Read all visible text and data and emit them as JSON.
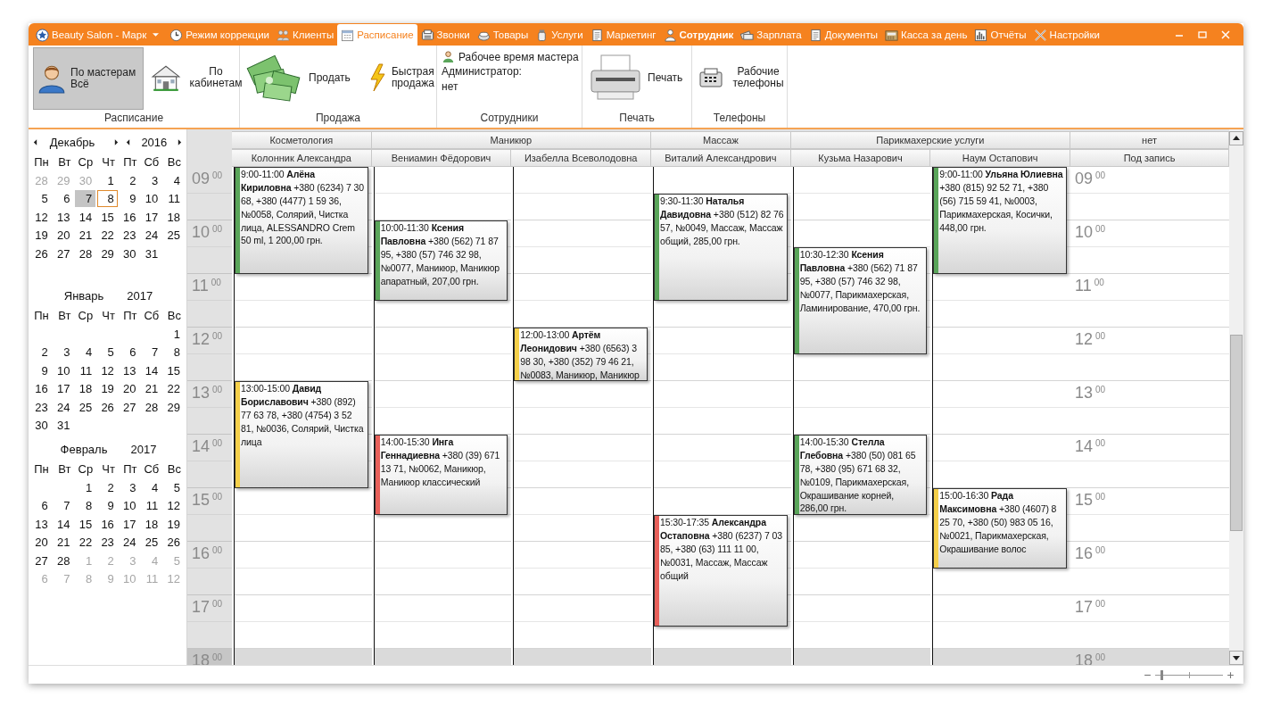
{
  "window": {
    "app_menu": "Beauty Salon - Марк"
  },
  "tabs": [
    {
      "label": "Режим коррекции",
      "selected": false,
      "emphasized": false
    },
    {
      "label": "Клиенты",
      "selected": false,
      "emphasized": false
    },
    {
      "label": "Расписание",
      "selected": true,
      "emphasized": false
    },
    {
      "label": "Звонки",
      "selected": false,
      "emphasized": false
    },
    {
      "label": "Товары",
      "selected": false,
      "emphasized": false
    },
    {
      "label": "Услуги",
      "selected": false,
      "emphasized": false
    },
    {
      "label": "Маркетинг",
      "selected": false,
      "emphasized": false
    },
    {
      "label": "Сотрудник",
      "selected": false,
      "emphasized": true
    },
    {
      "label": "Зарплата",
      "selected": false,
      "emphasized": false
    },
    {
      "label": "Документы",
      "selected": false,
      "emphasized": false
    },
    {
      "label": "Касса за день",
      "selected": false,
      "emphasized": false
    },
    {
      "label": "Отчёты",
      "selected": false,
      "emphasized": false
    },
    {
      "label": "Настройки",
      "selected": false,
      "emphasized": false
    }
  ],
  "ribbon": {
    "schedule_group": {
      "title": "Расписание",
      "by_masters": {
        "label": "По мастерам",
        "value": "Всё",
        "selected": true
      },
      "by_rooms": {
        "label": "По кабинетам",
        "selected": false
      }
    },
    "sale_group": {
      "title": "Продажа",
      "sell": "Продать",
      "quick_sale": "Быстрая продажа"
    },
    "staff_group": {
      "title": "Сотрудники",
      "work_time": "Рабочее время мастера",
      "administrator_label": "Администратор:",
      "administrator_value": "нет"
    },
    "print_group": {
      "title": "Печать",
      "print": "Печать"
    },
    "phones_group": {
      "title": "Телефоны",
      "work_phones": "Рабочие телефоны"
    }
  },
  "mini_calendar": [
    {
      "month": "Декабрь",
      "year": "2016",
      "navigation": true,
      "weekdays": [
        "Пн",
        "Вт",
        "Ср",
        "Чт",
        "Пт",
        "Сб",
        "Вс"
      ],
      "weeks": [
        [
          {
            "d": "28",
            "muted": true,
            "selected": false,
            "today": false
          },
          {
            "d": "29",
            "muted": true,
            "selected": false,
            "today": false
          },
          {
            "d": "30",
            "muted": true,
            "selected": false,
            "today": false
          },
          {
            "d": "1",
            "muted": false,
            "selected": false,
            "today": false
          },
          {
            "d": "2",
            "muted": false,
            "selected": false,
            "today": false
          },
          {
            "d": "3",
            "muted": false,
            "selected": false,
            "today": false
          },
          {
            "d": "4",
            "muted": false,
            "selected": false,
            "today": false
          }
        ],
        [
          {
            "d": "5",
            "muted": false,
            "selected": false,
            "today": false
          },
          {
            "d": "6",
            "muted": false,
            "selected": false,
            "today": false
          },
          {
            "d": "7",
            "muted": false,
            "selected": true,
            "today": false
          },
          {
            "d": "8",
            "muted": false,
            "selected": false,
            "today": true
          },
          {
            "d": "9",
            "muted": false,
            "selected": false,
            "today": false
          },
          {
            "d": "10",
            "muted": false,
            "selected": false,
            "today": false
          },
          {
            "d": "11",
            "muted": false,
            "selected": false,
            "today": false
          }
        ],
        [
          {
            "d": "12",
            "muted": false,
            "selected": false,
            "today": false
          },
          {
            "d": "13",
            "muted": false,
            "selected": false,
            "today": false
          },
          {
            "d": "14",
            "muted": false,
            "selected": false,
            "today": false
          },
          {
            "d": "15",
            "muted": false,
            "selected": false,
            "today": false
          },
          {
            "d": "16",
            "muted": false,
            "selected": false,
            "today": false
          },
          {
            "d": "17",
            "muted": false,
            "selected": false,
            "today": false
          },
          {
            "d": "18",
            "muted": false,
            "selected": false,
            "today": false
          }
        ],
        [
          {
            "d": "19",
            "muted": false,
            "selected": false,
            "today": false
          },
          {
            "d": "20",
            "muted": false,
            "selected": false,
            "today": false
          },
          {
            "d": "21",
            "muted": false,
            "selected": false,
            "today": false
          },
          {
            "d": "22",
            "muted": false,
            "selected": false,
            "today": false
          },
          {
            "d": "23",
            "muted": false,
            "selected": false,
            "today": false
          },
          {
            "d": "24",
            "muted": false,
            "selected": false,
            "today": false
          },
          {
            "d": "25",
            "muted": false,
            "selected": false,
            "today": false
          }
        ],
        [
          {
            "d": "26",
            "muted": false,
            "selected": false,
            "today": false
          },
          {
            "d": "27",
            "muted": false,
            "selected": false,
            "today": false
          },
          {
            "d": "28",
            "muted": false,
            "selected": false,
            "today": false
          },
          {
            "d": "29",
            "muted": false,
            "selected": false,
            "today": false
          },
          {
            "d": "30",
            "muted": false,
            "selected": false,
            "today": false
          },
          {
            "d": "31",
            "muted": false,
            "selected": false,
            "today": false
          }
        ]
      ]
    },
    {
      "month": "Январь",
      "year": "2017",
      "weekdays": [
        "Пн",
        "Вт",
        "Ср",
        "Чт",
        "Пт",
        "Сб",
        "Вс"
      ],
      "weeks": [
        [
          {
            "d": "1",
            "muted": false,
            "selected": false,
            "today": false
          }
        ],
        [
          {
            "d": "2",
            "muted": false,
            "selected": false,
            "today": false
          },
          {
            "d": "3",
            "muted": false,
            "selected": false,
            "today": false
          },
          {
            "d": "4",
            "muted": false,
            "selected": false,
            "today": false
          },
          {
            "d": "5",
            "muted": false,
            "selected": false,
            "today": false
          },
          {
            "d": "6",
            "muted": false,
            "selected": false,
            "today": false
          },
          {
            "d": "7",
            "muted": false,
            "selected": false,
            "today": false
          },
          {
            "d": "8",
            "muted": false,
            "selected": false,
            "today": false
          }
        ],
        [
          {
            "d": "9",
            "muted": false,
            "selected": false,
            "today": false
          },
          {
            "d": "10",
            "muted": false,
            "selected": false,
            "today": false
          },
          {
            "d": "11",
            "muted": false,
            "selected": false,
            "today": false
          },
          {
            "d": "12",
            "muted": false,
            "selected": false,
            "today": false
          },
          {
            "d": "13",
            "muted": false,
            "selected": false,
            "today": false
          },
          {
            "d": "14",
            "muted": false,
            "selected": false,
            "today": false
          },
          {
            "d": "15",
            "muted": false,
            "selected": false,
            "today": false
          }
        ],
        [
          {
            "d": "16",
            "muted": false,
            "selected": false,
            "today": false
          },
          {
            "d": "17",
            "muted": false,
            "selected": false,
            "today": false
          },
          {
            "d": "18",
            "muted": false,
            "selected": false,
            "today": false
          },
          {
            "d": "19",
            "muted": false,
            "selected": false,
            "today": false
          },
          {
            "d": "20",
            "muted": false,
            "selected": false,
            "today": false
          },
          {
            "d": "21",
            "muted": false,
            "selected": false,
            "today": false
          },
          {
            "d": "22",
            "muted": false,
            "selected": false,
            "today": false
          }
        ],
        [
          {
            "d": "23",
            "muted": false,
            "selected": false,
            "today": false
          },
          {
            "d": "24",
            "muted": false,
            "selected": false,
            "today": false
          },
          {
            "d": "25",
            "muted": false,
            "selected": false,
            "today": false
          },
          {
            "d": "26",
            "muted": false,
            "selected": false,
            "today": false
          },
          {
            "d": "27",
            "muted": false,
            "selected": false,
            "today": false
          },
          {
            "d": "28",
            "muted": false,
            "selected": false,
            "today": false
          },
          {
            "d": "29",
            "muted": false,
            "selected": false,
            "today": false
          }
        ],
        [
          {
            "d": "30",
            "muted": false,
            "selected": false,
            "today": false
          },
          {
            "d": "31",
            "muted": false,
            "selected": false,
            "today": false
          }
        ]
      ]
    },
    {
      "month": "Февраль",
      "year": "2017",
      "weekdays": [
        "Пн",
        "Вт",
        "Ср",
        "Чт",
        "Пт",
        "Сб",
        "Вс"
      ],
      "weeks": [
        [
          {
            "d": "1",
            "muted": false,
            "selected": false,
            "today": false
          },
          {
            "d": "2",
            "muted": false,
            "selected": false,
            "today": false
          },
          {
            "d": "3",
            "muted": false,
            "selected": false,
            "today": false
          },
          {
            "d": "4",
            "muted": false,
            "selected": false,
            "today": false
          },
          {
            "d": "5",
            "muted": false,
            "selected": false,
            "today": false
          }
        ],
        [
          {
            "d": "6",
            "muted": false,
            "selected": false,
            "today": false
          },
          {
            "d": "7",
            "muted": false,
            "selected": false,
            "today": false
          },
          {
            "d": "8",
            "muted": false,
            "selected": false,
            "today": false
          },
          {
            "d": "9",
            "muted": false,
            "selected": false,
            "today": false
          },
          {
            "d": "10",
            "muted": false,
            "selected": false,
            "today": false
          },
          {
            "d": "11",
            "muted": false,
            "selected": false,
            "today": false
          },
          {
            "d": "12",
            "muted": false,
            "selected": false,
            "today": false
          }
        ],
        [
          {
            "d": "13",
            "muted": false,
            "selected": false,
            "today": false
          },
          {
            "d": "14",
            "muted": false,
            "selected": false,
            "today": false
          },
          {
            "d": "15",
            "muted": false,
            "selected": false,
            "today": false
          },
          {
            "d": "16",
            "muted": false,
            "selected": false,
            "today": false
          },
          {
            "d": "17",
            "muted": false,
            "selected": false,
            "today": false
          },
          {
            "d": "18",
            "muted": false,
            "selected": false,
            "today": false
          },
          {
            "d": "19",
            "muted": false,
            "selected": false,
            "today": false
          }
        ],
        [
          {
            "d": "20",
            "muted": false,
            "selected": false,
            "today": false
          },
          {
            "d": "21",
            "muted": false,
            "selected": false,
            "today": false
          },
          {
            "d": "22",
            "muted": false,
            "selected": false,
            "today": false
          },
          {
            "d": "23",
            "muted": false,
            "selected": false,
            "today": false
          },
          {
            "d": "24",
            "muted": false,
            "selected": false,
            "today": false
          },
          {
            "d": "25",
            "muted": false,
            "selected": false,
            "today": false
          },
          {
            "d": "26",
            "muted": false,
            "selected": false,
            "today": false
          }
        ],
        [
          {
            "d": "27",
            "muted": false,
            "selected": false,
            "today": false
          },
          {
            "d": "28",
            "muted": false,
            "selected": false,
            "today": false
          },
          {
            "d": "1",
            "muted": true,
            "selected": false,
            "today": false
          },
          {
            "d": "2",
            "muted": true,
            "selected": false,
            "today": false
          },
          {
            "d": "3",
            "muted": true,
            "selected": false,
            "today": false
          },
          {
            "d": "4",
            "muted": true,
            "selected": false,
            "today": false
          },
          {
            "d": "5",
            "muted": true,
            "selected": false,
            "today": false
          }
        ],
        [
          {
            "d": "6",
            "muted": true,
            "selected": false,
            "today": false
          },
          {
            "d": "7",
            "muted": true,
            "selected": false,
            "today": false
          },
          {
            "d": "8",
            "muted": true,
            "selected": false,
            "today": false
          },
          {
            "d": "9",
            "muted": true,
            "selected": false,
            "today": false
          },
          {
            "d": "10",
            "muted": true,
            "selected": false,
            "today": false
          },
          {
            "d": "11",
            "muted": true,
            "selected": false,
            "today": false
          },
          {
            "d": "12",
            "muted": true,
            "selected": false,
            "today": false
          }
        ]
      ]
    }
  ],
  "schedule": {
    "time_column": [
      {
        "hour": "09",
        "minutes": "00",
        "working": true
      },
      {
        "hour": "10",
        "minutes": "00",
        "working": true
      },
      {
        "hour": "11",
        "minutes": "00",
        "working": true
      },
      {
        "hour": "12",
        "minutes": "00",
        "working": true
      },
      {
        "hour": "13",
        "minutes": "00",
        "working": true
      },
      {
        "hour": "14",
        "minutes": "00",
        "working": true
      },
      {
        "hour": "15",
        "minutes": "00",
        "working": true
      },
      {
        "hour": "16",
        "minutes": "00",
        "working": true
      },
      {
        "hour": "17",
        "minutes": "00",
        "working": true
      },
      {
        "hour": "18",
        "minutes": "00",
        "working": false
      }
    ],
    "groups": [
      {
        "name": "Косметология",
        "staff": [
          {
            "name": "Колонник Александра",
            "kind": "staff",
            "appointments": [
              {
                "text": "9:00-11:00 **Алёна Кириловна** +380 (6234) 7 30 68, +380 (4477) 1 59 36, №0058, Солярий, Чистка лица, ALESSANDRO Crem 50 ml, 1 200,00 грн.",
                "color": "#5aa55a"
              },
              {
                "text": "13:00-15:00 **Давид Бориславович** +380 (892) 77 63 78, +380 (4754) 3 52 81, №0036, Солярий, Чистка лица",
                "color": "#f5d04a"
              }
            ]
          }
        ]
      },
      {
        "name": "Маникюр",
        "staff": [
          {
            "name": "Вениамин Фёдорович",
            "kind": "staff",
            "appointments": [
              {
                "text": "10:00-11:30 **Ксения Павловна** +380 (562) 71 87 95, +380 (57) 746 32 98, №0077, Маникюр, Маникюр апаратный, 207,00 грн.",
                "color": "#5aa55a"
              },
              {
                "text": "14:00-15:30 **Инга Геннадиевна** +380 (39) 671 13 71, №0062, Маникюр, Маникюр классический",
                "color": "#e8605a"
              }
            ]
          },
          {
            "name": "Изабелла Всеволодовна",
            "kind": "staff",
            "appointments": [
              {
                "text": "12:00-13:00 **Артём Леонидович** +380 (6563) 3 98 30, +380 (352) 79 46 21, №0083, Маникюр, Маникюр",
                "color": "#f5d04a"
              }
            ]
          }
        ]
      },
      {
        "name": "Массаж",
        "staff": [
          {
            "name": "Виталий Александрович",
            "kind": "staff",
            "appointments": [
              {
                "text": "9:30-11:30 **Наталья Давидовна** +380 (512) 82 76 57, №0049, Массаж, Массаж общий, 285,00 грн.",
                "color": "#5aa55a"
              },
              {
                "text": "15:30-17:35 **Александра Остаповна** +380 (6237) 7 03 85, +380 (63) 111 11 00, №0031, Массаж, Массаж общий",
                "color": "#e8605a"
              }
            ]
          }
        ]
      },
      {
        "name": "Парикмахерские услуги",
        "staff": [
          {
            "name": "Кузьма Назарович",
            "kind": "staff",
            "appointments": [
              {
                "text": "10:30-12:30 **Ксения Павловна** +380 (562) 71 87 95, +380 (57) 746 32 98, №0077, Парикмахерская, Ламинирование, 470,00 грн.",
                "color": "#5aa55a"
              },
              {
                "text": "14:00-15:30 **Стелла Глебовна** +380 (50) 081 65 78, +380 (95) 671 68 32, №0109, Парикмахерская, Окрашивание корней, 286,00 грн.",
                "color": "#5aa55a"
              }
            ]
          },
          {
            "name": "Наум Остапович",
            "kind": "staff",
            "appointments": [
              {
                "text": "9:00-11:00 **Ульяна Юлиевна** +380 (815) 92 52 71, +380 (56) 715 59 41, №0003, Парикмахерская, Косички, 448,00 грн.",
                "color": "#5aa55a"
              },
              {
                "text": "15:00-16:30 **Рада Максимовна** +380 (4607) 8 25 70, +380 (50) 983 05 16, №0021, Парикмахерская, Окрашивание волос",
                "color": "#f5d04a"
              }
            ]
          }
        ]
      },
      {
        "name": "нет",
        "staff": [
          {
            "name": "Под запись",
            "kind": "unassigned",
            "hour_marks": [
              {
                "hour": "09",
                "minutes": "00"
              },
              {
                "hour": "10",
                "minutes": "00"
              },
              {
                "hour": "11",
                "minutes": "00"
              },
              {
                "hour": "12",
                "minutes": "00"
              },
              {
                "hour": "13",
                "minutes": "00"
              },
              {
                "hour": "14",
                "minutes": "00"
              },
              {
                "hour": "15",
                "minutes": "00"
              },
              {
                "hour": "16",
                "minutes": "00"
              },
              {
                "hour": "17",
                "minutes": "00"
              },
              {
                "hour": "18",
                "minutes": "00"
              }
            ]
          }
        ]
      }
    ]
  },
  "status_bar": {
    "zoom": {
      "level": 0.08
    }
  }
}
